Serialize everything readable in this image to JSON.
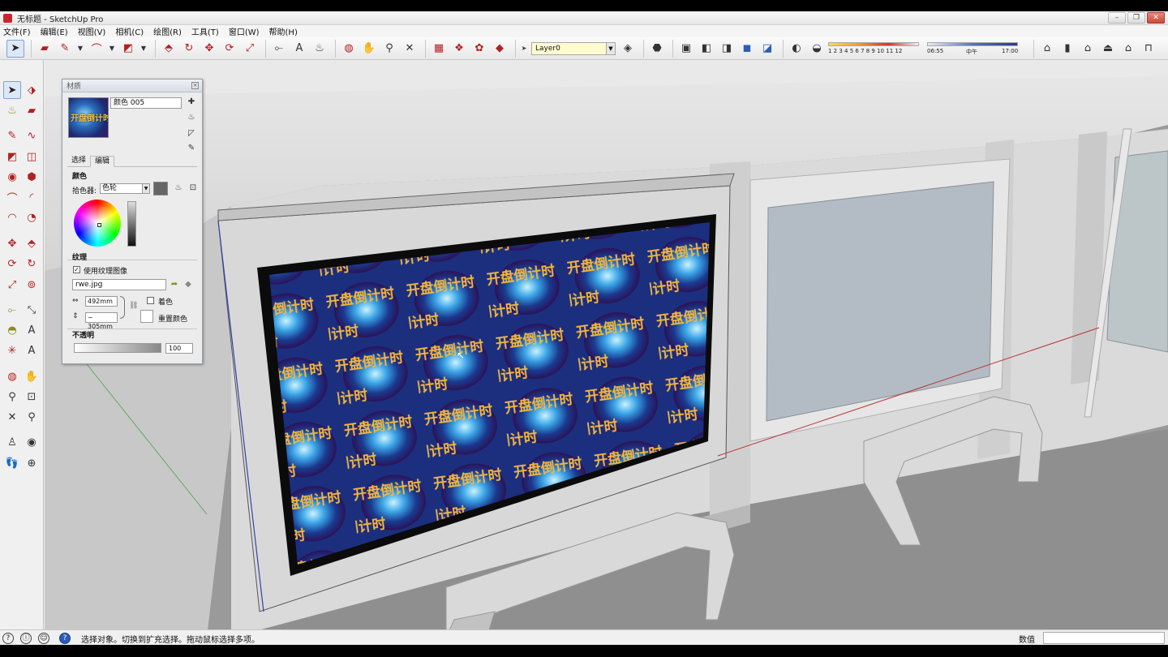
{
  "window": {
    "title": "无标题 - SketchUp Pro",
    "min": "–",
    "max": "❐",
    "close": "✕"
  },
  "menu": [
    "文件(F)",
    "编辑(E)",
    "视图(V)",
    "相机(C)",
    "绘图(R)",
    "工具(T)",
    "窗口(W)",
    "帮助(H)"
  ],
  "toolbar": {
    "layer": "Layer0",
    "shadow_months": "1 2 3 4 5 6 7 8 9 10 11 12",
    "time_start": "06:55",
    "time_mid": "中午",
    "time_end": "17:00"
  },
  "materials": {
    "title": "材质",
    "thumb_text": "开盘倒计时",
    "name": "颜色 005",
    "tab_select": "选择",
    "tab_edit": "编辑",
    "color_section": "颜色",
    "picker_label": "拾色器:",
    "picker_value": "色轮",
    "texture_section": "纹理",
    "use_texture": "使用纹理图像",
    "texture_file": "rwe.jpg",
    "width": "492mm",
    "height": "~ 305mm",
    "colorize": "着色",
    "reset_color": "重置颜色",
    "opacity_section": "不透明",
    "opacity_value": "100"
  },
  "scene": {
    "screen_text": "开盘倒计时"
  },
  "status": {
    "text": "选择对象。切换到扩充选择。拖动鼠标选择多项。",
    "vcb_label": "数值",
    "vcb_value": ""
  },
  "colors": {
    "accent": "#c8262b",
    "viewport_bg": "#9a9a9a",
    "screen_blue": "#1e4fa8",
    "screen_text": "#f2b640"
  }
}
